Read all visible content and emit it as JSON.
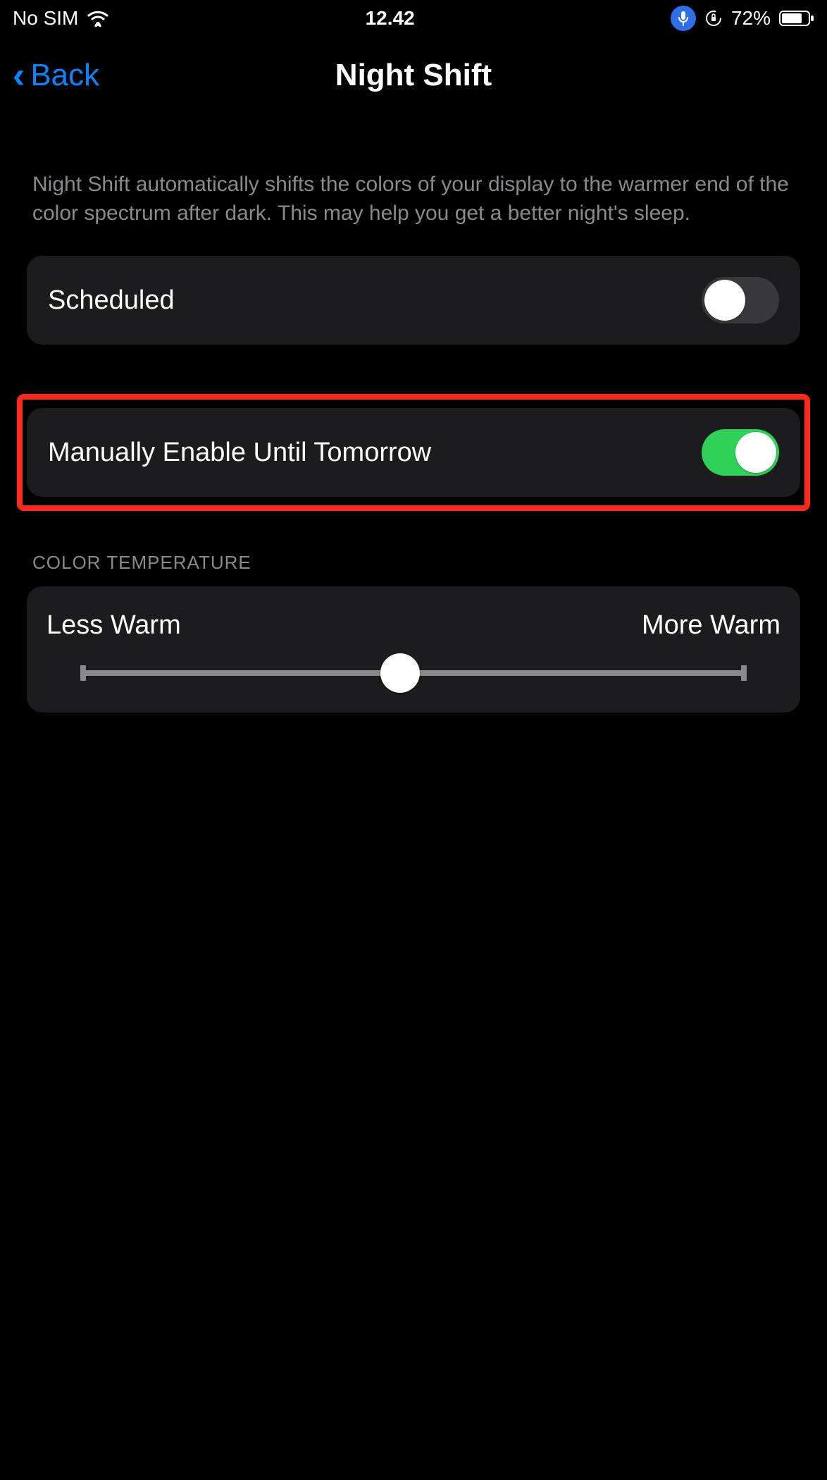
{
  "status_bar": {
    "carrier": "No SIM",
    "time": "12.42",
    "battery_pct": "72%"
  },
  "nav": {
    "back_label": "Back",
    "title": "Night Shift"
  },
  "description": "Night Shift automatically shifts the colors of your display to the warmer end of the color spectrum after dark. This may help you get a better night's sleep.",
  "scheduled": {
    "label": "Scheduled",
    "on": false
  },
  "manual": {
    "label": "Manually Enable Until Tomorrow",
    "on": true,
    "highlighted": true
  },
  "color_temp": {
    "header": "COLOR TEMPERATURE",
    "min_label": "Less Warm",
    "max_label": "More Warm",
    "value_pct": 48
  },
  "colors": {
    "accent": "#0a84ff",
    "toggle_on": "#30d158",
    "highlight": "#ff2a1a",
    "cell_bg": "#1c1c1e",
    "secondary_text": "#8a8a8e"
  }
}
